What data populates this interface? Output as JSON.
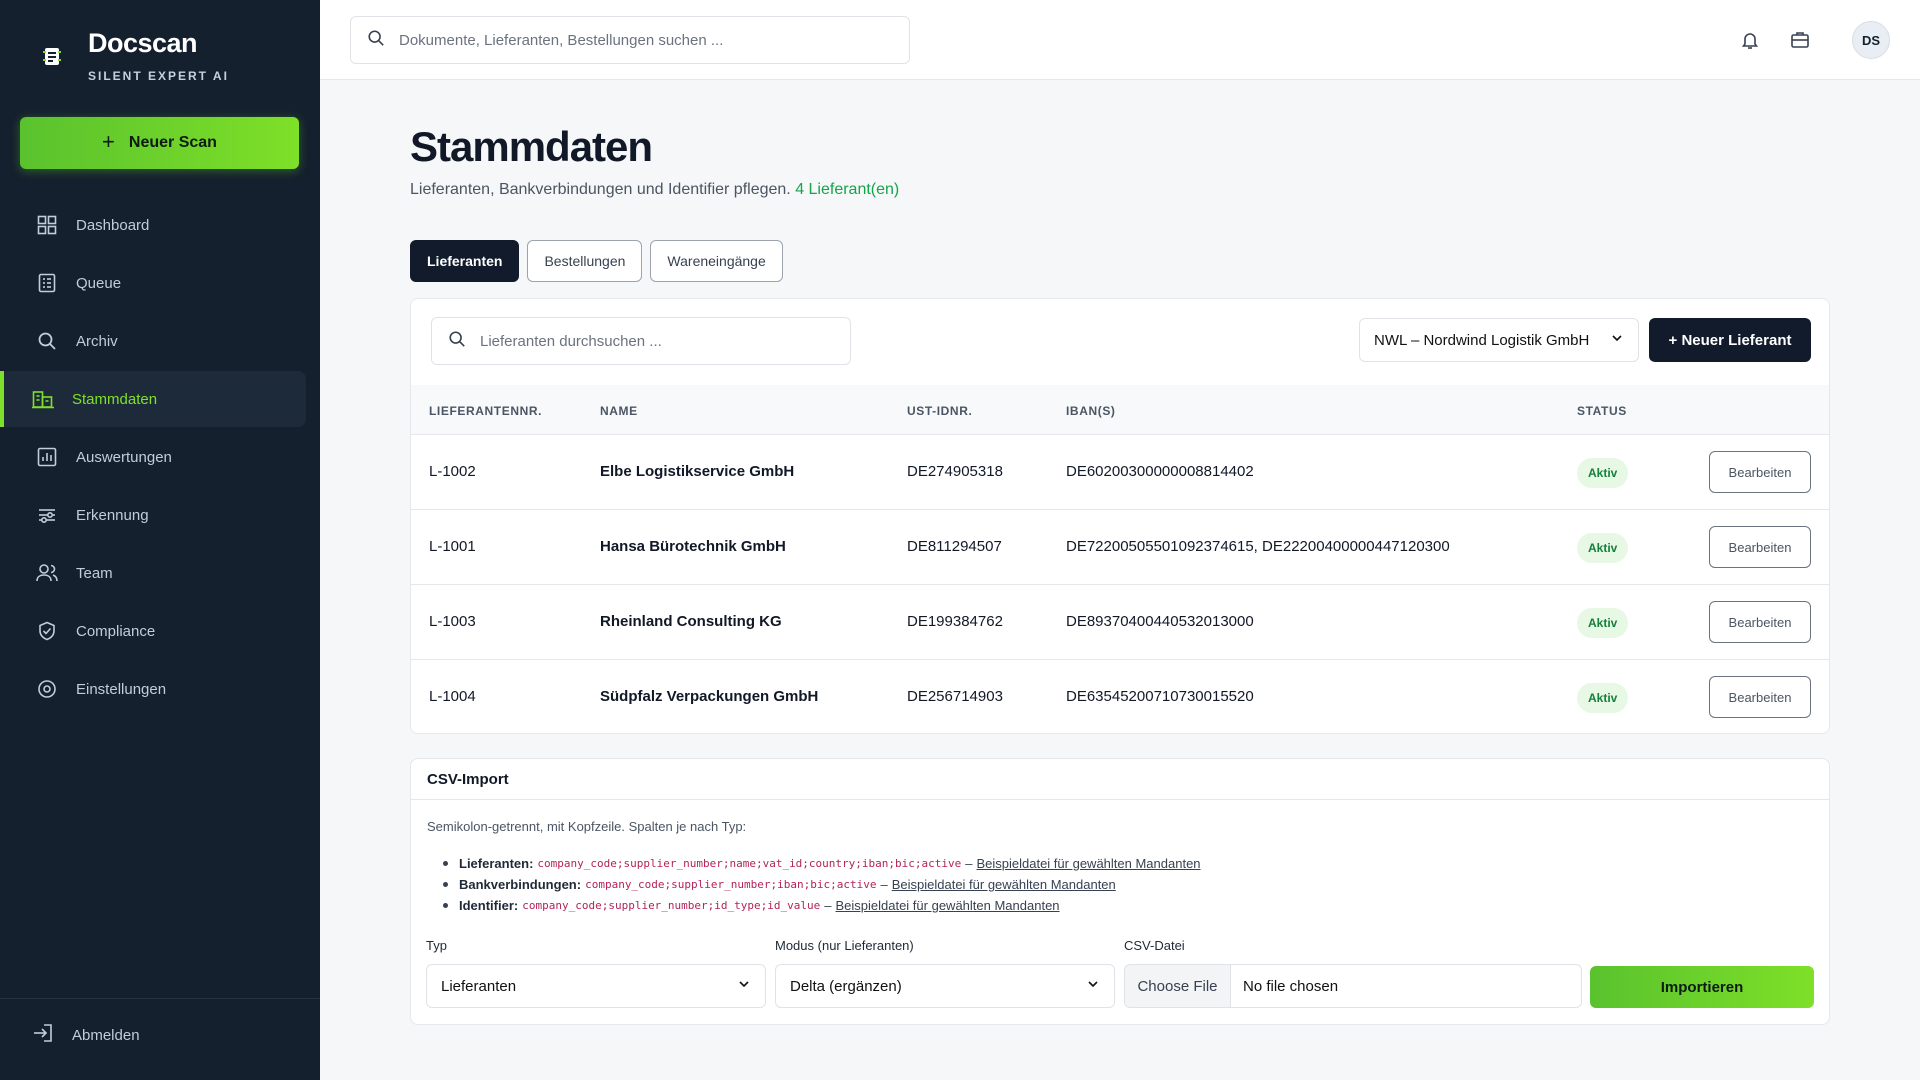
{
  "app": {
    "name": "Docscan",
    "tagline": "SILENT EXPERT AI"
  },
  "sidebar": {
    "new_scan_label": "Neuer Scan",
    "items": [
      {
        "label": "Dashboard",
        "icon": "dashboard-icon"
      },
      {
        "label": "Queue",
        "icon": "queue-icon"
      },
      {
        "label": "Archiv",
        "icon": "search-icon"
      },
      {
        "label": "Stammdaten",
        "icon": "building-icon",
        "active": true
      },
      {
        "label": "Auswertungen",
        "icon": "chart-icon"
      },
      {
        "label": "Erkennung",
        "icon": "sliders-icon"
      },
      {
        "label": "Team",
        "icon": "users-icon"
      },
      {
        "label": "Compliance",
        "icon": "shield-icon"
      },
      {
        "label": "Einstellungen",
        "icon": "gear-icon"
      }
    ],
    "logout_label": "Abmelden"
  },
  "header": {
    "search_placeholder": "Dokumente, Lieferanten, Bestellungen suchen ...",
    "avatar_initials": "DS"
  },
  "page": {
    "title": "Stammdaten",
    "subtitle": "Lieferanten, Bankverbindungen und Identifier pflegen.",
    "count_label": "4 Lieferant(en)",
    "tabs": [
      {
        "label": "Lieferanten",
        "active": true
      },
      {
        "label": "Bestellungen"
      },
      {
        "label": "Wareneingänge"
      }
    ]
  },
  "suppliers": {
    "search_placeholder": "Lieferanten durchsuchen ...",
    "mandant_selected": "NWL – Nordwind Logistik GmbH",
    "new_button_label": "+ Neuer Lieferant",
    "columns": [
      "LIEFERANTENNR.",
      "NAME",
      "UST-IDNR.",
      "IBAN(S)",
      "STATUS"
    ],
    "rows": [
      {
        "number": "L-1002",
        "name": "Elbe Logistikservice GmbH",
        "vat": "DE274905318",
        "iban": "DE60200300000008814402",
        "status": "Aktiv"
      },
      {
        "number": "L-1001",
        "name": "Hansa Bürotechnik GmbH",
        "vat": "DE811294507",
        "iban": "DE72200505501092374615, DE22200400000447120300",
        "status": "Aktiv"
      },
      {
        "number": "L-1003",
        "name": "Rheinland Consulting KG",
        "vat": "DE199384762",
        "iban": "DE89370400440532013000",
        "status": "Aktiv"
      },
      {
        "number": "L-1004",
        "name": "Südpfalz Verpackungen GmbH",
        "vat": "DE256714903",
        "iban": "DE63545200710730015520",
        "status": "Aktiv"
      }
    ],
    "edit_label": "Bearbeiten"
  },
  "csv": {
    "title": "CSV-Import",
    "description": "Semikolon-getrennt, mit Kopfzeile. Spalten je nach Typ:",
    "types": [
      {
        "label": "Lieferanten:",
        "columns": "company_code;supplier_number;name;vat_id;country;iban;bic;active",
        "link": "Beispieldatei für gewählten Mandanten"
      },
      {
        "label": "Bankverbindungen:",
        "columns": "company_code;supplier_number;iban;bic;active",
        "link": "Beispieldatei für gewählten Mandanten"
      },
      {
        "label": "Identifier:",
        "columns": "company_code;supplier_number;id_type;id_value",
        "link": "Beispieldatei für gewählten Mandanten"
      }
    ],
    "separator": "–",
    "type_label": "Typ",
    "type_value": "Lieferanten",
    "mode_label": "Modus (nur Lieferanten)",
    "mode_value": "Delta (ergänzen)",
    "file_label": "CSV-Datei",
    "file_button": "Choose File",
    "file_status": "No file chosen",
    "import_label": "Importieren"
  }
}
